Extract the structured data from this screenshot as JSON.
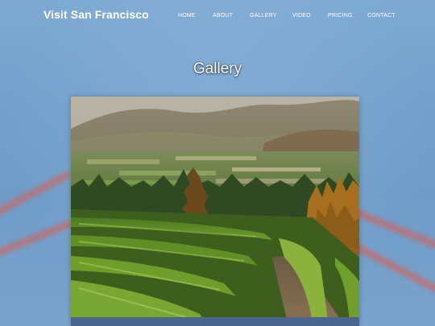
{
  "site": {
    "brand": "Visit San Francisco"
  },
  "nav": {
    "items": [
      {
        "label": "HOME"
      },
      {
        "label": "ABOUT"
      },
      {
        "label": "GALLERY"
      },
      {
        "label": "VIDEO"
      },
      {
        "label": "PRICING"
      },
      {
        "label": "CONTACT"
      }
    ]
  },
  "main": {
    "title": "Gallery",
    "image_icon": "vineyard-photo"
  },
  "colors": {
    "background": "#739fcb",
    "text": "#ffffff",
    "cable": "#d66054"
  }
}
